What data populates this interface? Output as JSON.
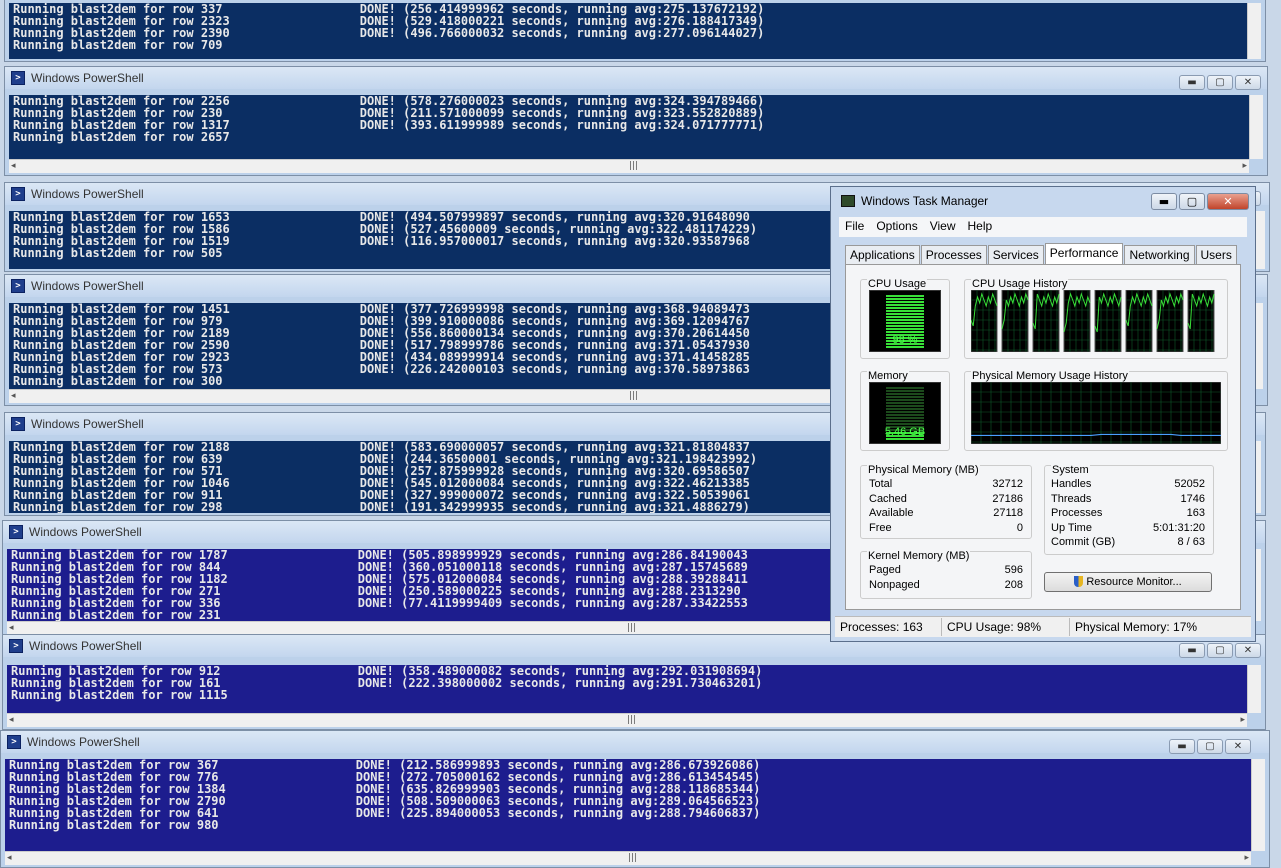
{
  "window_title": "Windows PowerShell",
  "ps_windows": [
    {
      "show_title": false,
      "lines": [
        {
          "run": "Running blast2dem for row 337",
          "done": "DONE! (256.414999962 seconds, running avg:275.137672192)"
        },
        {
          "run": "Running blast2dem for row 2323",
          "done": "DONE! (529.418000221 seconds, running avg:276.188417349)"
        },
        {
          "run": "Running blast2dem for row 2390",
          "done": "DONE! (496.766000032 seconds, running avg:277.096144027)"
        },
        {
          "run": "Running blast2dem for row 709",
          "done": ""
        }
      ]
    },
    {
      "show_title": true,
      "lines": [
        {
          "run": "Running blast2dem for row 2256",
          "done": "DONE! (578.276000023 seconds, running avg:324.394789466)"
        },
        {
          "run": "Running blast2dem for row 230",
          "done": "DONE! (211.571000099 seconds, running avg:323.552820889)"
        },
        {
          "run": "Running blast2dem for row 1317",
          "done": "DONE! (393.611999989 seconds, running avg:324.071777771)"
        },
        {
          "run": "Running blast2dem for row 2657",
          "done": ""
        }
      ]
    },
    {
      "show_title": true,
      "lines": [
        {
          "run": "Running blast2dem for row 1653",
          "done": "DONE! (494.507999897 seconds, running avg:320.91648090"
        },
        {
          "run": "Running blast2dem for row 1586",
          "done": "DONE! (527.45600009 seconds, running avg:322.481174229)"
        },
        {
          "run": "Running blast2dem for row 1519",
          "done": "DONE! (116.957000017 seconds, running avg:320.93587968"
        },
        {
          "run": "Running blast2dem for row 505",
          "done": ""
        }
      ]
    },
    {
      "show_title": true,
      "lines": [
        {
          "run": "Running blast2dem for row 1451",
          "done": "DONE! (377.726999998 seconds, running avg:368.94089473"
        },
        {
          "run": "Running blast2dem for row 979",
          "done": "DONE! (399.910000086 seconds, running avg:369.12094767"
        },
        {
          "run": "Running blast2dem for row 2189",
          "done": "DONE! (556.860000134 seconds, running avg:370.20614450"
        },
        {
          "run": "Running blast2dem for row 2590",
          "done": "DONE! (517.798999786 seconds, running avg:371.05437930"
        },
        {
          "run": "Running blast2dem for row 2923",
          "done": "DONE! (434.089999914 seconds, running avg:371.41458285"
        },
        {
          "run": "Running blast2dem for row 573",
          "done": "DONE! (226.242000103 seconds, running avg:370.58973863"
        },
        {
          "run": "Running blast2dem for row 300",
          "done": ""
        }
      ]
    },
    {
      "show_title": true,
      "lines": [
        {
          "run": "Running blast2dem for row 2188",
          "done": "DONE! (583.690000057 seconds, running avg:321.81804837"
        },
        {
          "run": "Running blast2dem for row 639",
          "done": "DONE! (244.36500001 seconds, running avg:321.198423992)"
        },
        {
          "run": "Running blast2dem for row 571",
          "done": "DONE! (257.875999928 seconds, running avg:320.69586507"
        },
        {
          "run": "Running blast2dem for row 1046",
          "done": "DONE! (545.012000084 seconds, running avg:322.46213385"
        },
        {
          "run": "Running blast2dem for row 911",
          "done": "DONE! (327.999000072 seconds, running avg:322.50539061"
        },
        {
          "run": "Running blast2dem for row 298",
          "done": "DONE! (191.342999935 seconds, running avg:321.4886279)"
        }
      ]
    },
    {
      "show_title": true,
      "lines": [
        {
          "run": "Running blast2dem for row 1787",
          "done": "DONE! (505.898999929 seconds, running avg:286.84190043"
        },
        {
          "run": "Running blast2dem for row 844",
          "done": "DONE! (360.051000118 seconds, running avg:287.15745689"
        },
        {
          "run": "Running blast2dem for row 1182",
          "done": "DONE! (575.012000084 seconds, running avg:288.39288411"
        },
        {
          "run": "Running blast2dem for row 271",
          "done": "DONE! (250.589000225 seconds, running avg:288.2313290"
        },
        {
          "run": "Running blast2dem for row 336",
          "done": "DONE! (77.4119999409 seconds, running avg:287.33422553"
        },
        {
          "run": "Running blast2dem for row 231",
          "done": ""
        }
      ]
    },
    {
      "show_title": true,
      "lines": [
        {
          "run": "Running blast2dem for row 912",
          "done": "DONE! (358.489000082 seconds, running avg:292.031908694)"
        },
        {
          "run": "Running blast2dem for row 161",
          "done": "DONE! (222.398000002 seconds, running avg:291.730463201)"
        },
        {
          "run": "Running blast2dem for row 1115",
          "done": ""
        }
      ]
    },
    {
      "show_title": true,
      "lines": [
        {
          "run": "Running blast2dem for row 367",
          "done": "DONE! (212.586999893 seconds, running avg:286.673926086)"
        },
        {
          "run": "Running blast2dem for row 776",
          "done": "DONE! (272.705000162 seconds, running avg:286.613454545)"
        },
        {
          "run": "Running blast2dem for row 1384",
          "done": "DONE! (635.826999903 seconds, running avg:288.118685344)"
        },
        {
          "run": "Running blast2dem for row 2790",
          "done": "DONE! (508.509000063 seconds, running avg:289.064566523)"
        },
        {
          "run": "Running blast2dem for row 641",
          "done": "DONE! (225.894000053 seconds, running avg:288.794606837)"
        },
        {
          "run": "Running blast2dem for row 980",
          "done": ""
        }
      ]
    }
  ],
  "window_controls": {
    "minimize": "▬",
    "maximize": "▢",
    "close": "✕"
  },
  "scroll_grip": "|||",
  "task_manager": {
    "title": "Windows Task Manager",
    "menu": [
      "File",
      "Options",
      "View",
      "Help"
    ],
    "tabs": [
      "Applications",
      "Processes",
      "Services",
      "Performance",
      "Networking",
      "Users"
    ],
    "active_tab": "Performance",
    "cpu_usage_label": "CPU Usage",
    "cpu_usage_value": "98 %",
    "cpu_fraction": 0.98,
    "cpu_history_label": "CPU Usage History",
    "memory_label": "Memory",
    "memory_value": "5.46 GB",
    "memory_history_label": "Physical Memory Usage History",
    "physical_memory": {
      "label": "Physical Memory (MB)",
      "rows": [
        [
          "Total",
          "32712"
        ],
        [
          "Cached",
          "27186"
        ],
        [
          "Available",
          "27118"
        ],
        [
          "Free",
          "0"
        ]
      ]
    },
    "kernel_memory": {
      "label": "Kernel Memory (MB)",
      "rows": [
        [
          "Paged",
          "596"
        ],
        [
          "Nonpaged",
          "208"
        ]
      ]
    },
    "system": {
      "label": "System",
      "rows": [
        [
          "Handles",
          "52052"
        ],
        [
          "Threads",
          "1746"
        ],
        [
          "Processes",
          "163"
        ],
        [
          "Up Time",
          "5:01:31:20"
        ],
        [
          "Commit (GB)",
          "8 / 63"
        ]
      ]
    },
    "resource_monitor_button": "Resource Monitor...",
    "status": {
      "processes": "Processes: 163",
      "cpu": "CPU Usage: 98%",
      "memory": "Physical Memory: 17%"
    },
    "colors": {
      "graph_green": "#38e038",
      "console_blue": "#1d1d8e",
      "console_dark": "#0b2e63"
    }
  }
}
